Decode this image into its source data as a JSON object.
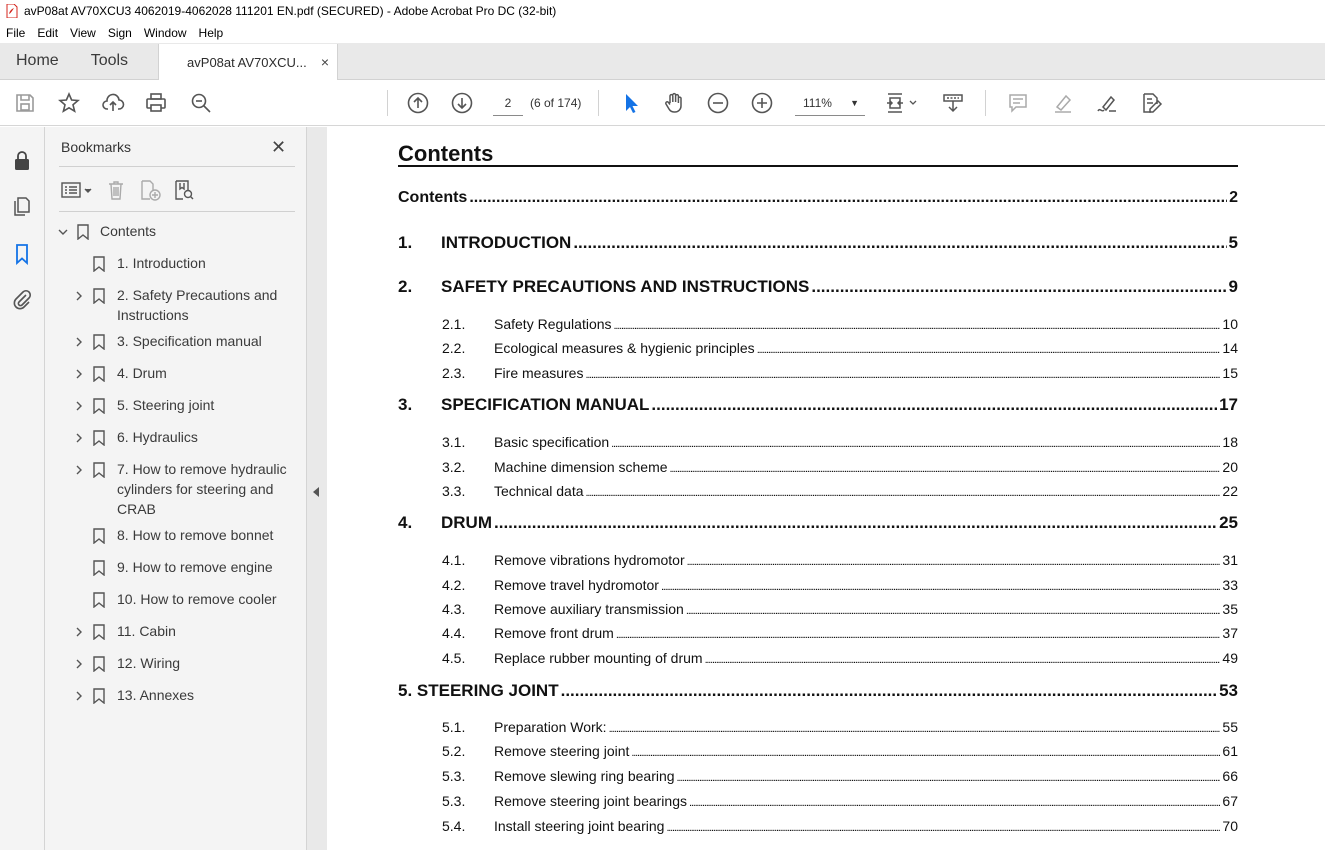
{
  "window": {
    "title": "avP08at AV70XCU3 4062019-4062028 111201 EN.pdf (SECURED) - Adobe Acrobat Pro DC (32-bit)"
  },
  "menu": [
    "File",
    "Edit",
    "View",
    "Sign",
    "Window",
    "Help"
  ],
  "tabs": {
    "home": "Home",
    "tools": "Tools",
    "doc": "avP08at AV70XCU...",
    "close": "×"
  },
  "toolbar": {
    "page_current": "2",
    "page_of": "(6 of 174)",
    "zoom": "111%"
  },
  "bookmarks": {
    "title": "Bookmarks",
    "close": "✕",
    "items": [
      {
        "label": "Contents",
        "expanded": true
      },
      {
        "label": "1. Introduction"
      },
      {
        "label": "2. Safety Precautions and Instructions"
      },
      {
        "label": "3. Specification manual"
      },
      {
        "label": "4. Drum"
      },
      {
        "label": "5. Steering joint"
      },
      {
        "label": "6. Hydraulics"
      },
      {
        "label": "7. How to remove hydraulic cylinders for steering and CRAB"
      },
      {
        "label": "8. How to remove bonnet"
      },
      {
        "label": "9. How to remove engine"
      },
      {
        "label": "10. How to remove cooler"
      },
      {
        "label": "11. Cabin"
      },
      {
        "label": "12. Wiring"
      },
      {
        "label": "13. Annexes"
      }
    ]
  },
  "document": {
    "heading": "Contents",
    "toc": [
      {
        "num": "",
        "title": "Contents",
        "page": "2"
      },
      {
        "num": "1.",
        "title": "INTRODUCTION",
        "page": "5"
      },
      {
        "num": "2.",
        "title": "SAFETY PRECAUTIONS AND INSTRUCTIONS",
        "page": "9"
      },
      {
        "num": "2.1.",
        "title": "Safety Regulations",
        "page": "10"
      },
      {
        "num": "2.2.",
        "title": "Ecological measures & hygienic principles",
        "page": "14"
      },
      {
        "num": "2.3.",
        "title": "Fire measures",
        "page": "15"
      },
      {
        "num": "3.",
        "title": "SPECIFICATION MANUAL",
        "page": "17"
      },
      {
        "num": "3.1.",
        "title": "Basic specification",
        "page": "18"
      },
      {
        "num": "3.2.",
        "title": "Machine dimension scheme",
        "page": "20"
      },
      {
        "num": "3.3.",
        "title": "Technical data",
        "page": "22"
      },
      {
        "num": "4.",
        "title": "DRUM",
        "page": "25"
      },
      {
        "num": "4.1.",
        "title": "Remove vibrations hydromotor",
        "page": "31"
      },
      {
        "num": "4.2.",
        "title": "Remove travel hydromotor",
        "page": "33"
      },
      {
        "num": "4.3.",
        "title": "Remove auxiliary transmission",
        "page": "35"
      },
      {
        "num": "4.4.",
        "title": "Remove front drum",
        "page": "37"
      },
      {
        "num": "4.5.",
        "title": "Replace rubber mounting of drum",
        "page": "49"
      },
      {
        "num": "",
        "title": "5. STEERING JOINT",
        "page": "53"
      },
      {
        "num": "5.1.",
        "title": "Preparation Work:",
        "page": "55"
      },
      {
        "num": "5.2.",
        "title": "Remove steering joint",
        "page": "61"
      },
      {
        "num": "5.3.",
        "title": "Remove slewing ring bearing",
        "page": "66"
      },
      {
        "num": "5.3.",
        "title": "Remove steering joint bearings",
        "page": "67"
      },
      {
        "num": "5.4.",
        "title": "Install steering joint bearing",
        "page": "70"
      }
    ]
  },
  "colors": {
    "accent_blue": "#1473e6",
    "icon_gray": "#555555",
    "pdf_red": "#d4241c"
  }
}
